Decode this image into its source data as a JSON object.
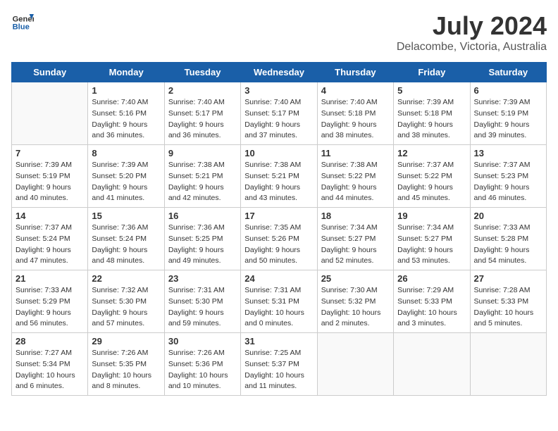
{
  "header": {
    "logo_general": "General",
    "logo_blue": "Blue",
    "title": "July 2024",
    "subtitle": "Delacombe, Victoria, Australia"
  },
  "calendar": {
    "days_of_week": [
      "Sunday",
      "Monday",
      "Tuesday",
      "Wednesday",
      "Thursday",
      "Friday",
      "Saturday"
    ],
    "weeks": [
      [
        {
          "day": "",
          "info": ""
        },
        {
          "day": "1",
          "info": "Sunrise: 7:40 AM\nSunset: 5:16 PM\nDaylight: 9 hours\nand 36 minutes."
        },
        {
          "day": "2",
          "info": "Sunrise: 7:40 AM\nSunset: 5:17 PM\nDaylight: 9 hours\nand 36 minutes."
        },
        {
          "day": "3",
          "info": "Sunrise: 7:40 AM\nSunset: 5:17 PM\nDaylight: 9 hours\nand 37 minutes."
        },
        {
          "day": "4",
          "info": "Sunrise: 7:40 AM\nSunset: 5:18 PM\nDaylight: 9 hours\nand 38 minutes."
        },
        {
          "day": "5",
          "info": "Sunrise: 7:39 AM\nSunset: 5:18 PM\nDaylight: 9 hours\nand 38 minutes."
        },
        {
          "day": "6",
          "info": "Sunrise: 7:39 AM\nSunset: 5:19 PM\nDaylight: 9 hours\nand 39 minutes."
        }
      ],
      [
        {
          "day": "7",
          "info": "Sunrise: 7:39 AM\nSunset: 5:19 PM\nDaylight: 9 hours\nand 40 minutes."
        },
        {
          "day": "8",
          "info": "Sunrise: 7:39 AM\nSunset: 5:20 PM\nDaylight: 9 hours\nand 41 minutes."
        },
        {
          "day": "9",
          "info": "Sunrise: 7:38 AM\nSunset: 5:21 PM\nDaylight: 9 hours\nand 42 minutes."
        },
        {
          "day": "10",
          "info": "Sunrise: 7:38 AM\nSunset: 5:21 PM\nDaylight: 9 hours\nand 43 minutes."
        },
        {
          "day": "11",
          "info": "Sunrise: 7:38 AM\nSunset: 5:22 PM\nDaylight: 9 hours\nand 44 minutes."
        },
        {
          "day": "12",
          "info": "Sunrise: 7:37 AM\nSunset: 5:22 PM\nDaylight: 9 hours\nand 45 minutes."
        },
        {
          "day": "13",
          "info": "Sunrise: 7:37 AM\nSunset: 5:23 PM\nDaylight: 9 hours\nand 46 minutes."
        }
      ],
      [
        {
          "day": "14",
          "info": "Sunrise: 7:37 AM\nSunset: 5:24 PM\nDaylight: 9 hours\nand 47 minutes."
        },
        {
          "day": "15",
          "info": "Sunrise: 7:36 AM\nSunset: 5:24 PM\nDaylight: 9 hours\nand 48 minutes."
        },
        {
          "day": "16",
          "info": "Sunrise: 7:36 AM\nSunset: 5:25 PM\nDaylight: 9 hours\nand 49 minutes."
        },
        {
          "day": "17",
          "info": "Sunrise: 7:35 AM\nSunset: 5:26 PM\nDaylight: 9 hours\nand 50 minutes."
        },
        {
          "day": "18",
          "info": "Sunrise: 7:34 AM\nSunset: 5:27 PM\nDaylight: 9 hours\nand 52 minutes."
        },
        {
          "day": "19",
          "info": "Sunrise: 7:34 AM\nSunset: 5:27 PM\nDaylight: 9 hours\nand 53 minutes."
        },
        {
          "day": "20",
          "info": "Sunrise: 7:33 AM\nSunset: 5:28 PM\nDaylight: 9 hours\nand 54 minutes."
        }
      ],
      [
        {
          "day": "21",
          "info": "Sunrise: 7:33 AM\nSunset: 5:29 PM\nDaylight: 9 hours\nand 56 minutes."
        },
        {
          "day": "22",
          "info": "Sunrise: 7:32 AM\nSunset: 5:30 PM\nDaylight: 9 hours\nand 57 minutes."
        },
        {
          "day": "23",
          "info": "Sunrise: 7:31 AM\nSunset: 5:30 PM\nDaylight: 9 hours\nand 59 minutes."
        },
        {
          "day": "24",
          "info": "Sunrise: 7:31 AM\nSunset: 5:31 PM\nDaylight: 10 hours\nand 0 minutes."
        },
        {
          "day": "25",
          "info": "Sunrise: 7:30 AM\nSunset: 5:32 PM\nDaylight: 10 hours\nand 2 minutes."
        },
        {
          "day": "26",
          "info": "Sunrise: 7:29 AM\nSunset: 5:33 PM\nDaylight: 10 hours\nand 3 minutes."
        },
        {
          "day": "27",
          "info": "Sunrise: 7:28 AM\nSunset: 5:33 PM\nDaylight: 10 hours\nand 5 minutes."
        }
      ],
      [
        {
          "day": "28",
          "info": "Sunrise: 7:27 AM\nSunset: 5:34 PM\nDaylight: 10 hours\nand 6 minutes."
        },
        {
          "day": "29",
          "info": "Sunrise: 7:26 AM\nSunset: 5:35 PM\nDaylight: 10 hours\nand 8 minutes."
        },
        {
          "day": "30",
          "info": "Sunrise: 7:26 AM\nSunset: 5:36 PM\nDaylight: 10 hours\nand 10 minutes."
        },
        {
          "day": "31",
          "info": "Sunrise: 7:25 AM\nSunset: 5:37 PM\nDaylight: 10 hours\nand 11 minutes."
        },
        {
          "day": "",
          "info": ""
        },
        {
          "day": "",
          "info": ""
        },
        {
          "day": "",
          "info": ""
        }
      ]
    ]
  }
}
